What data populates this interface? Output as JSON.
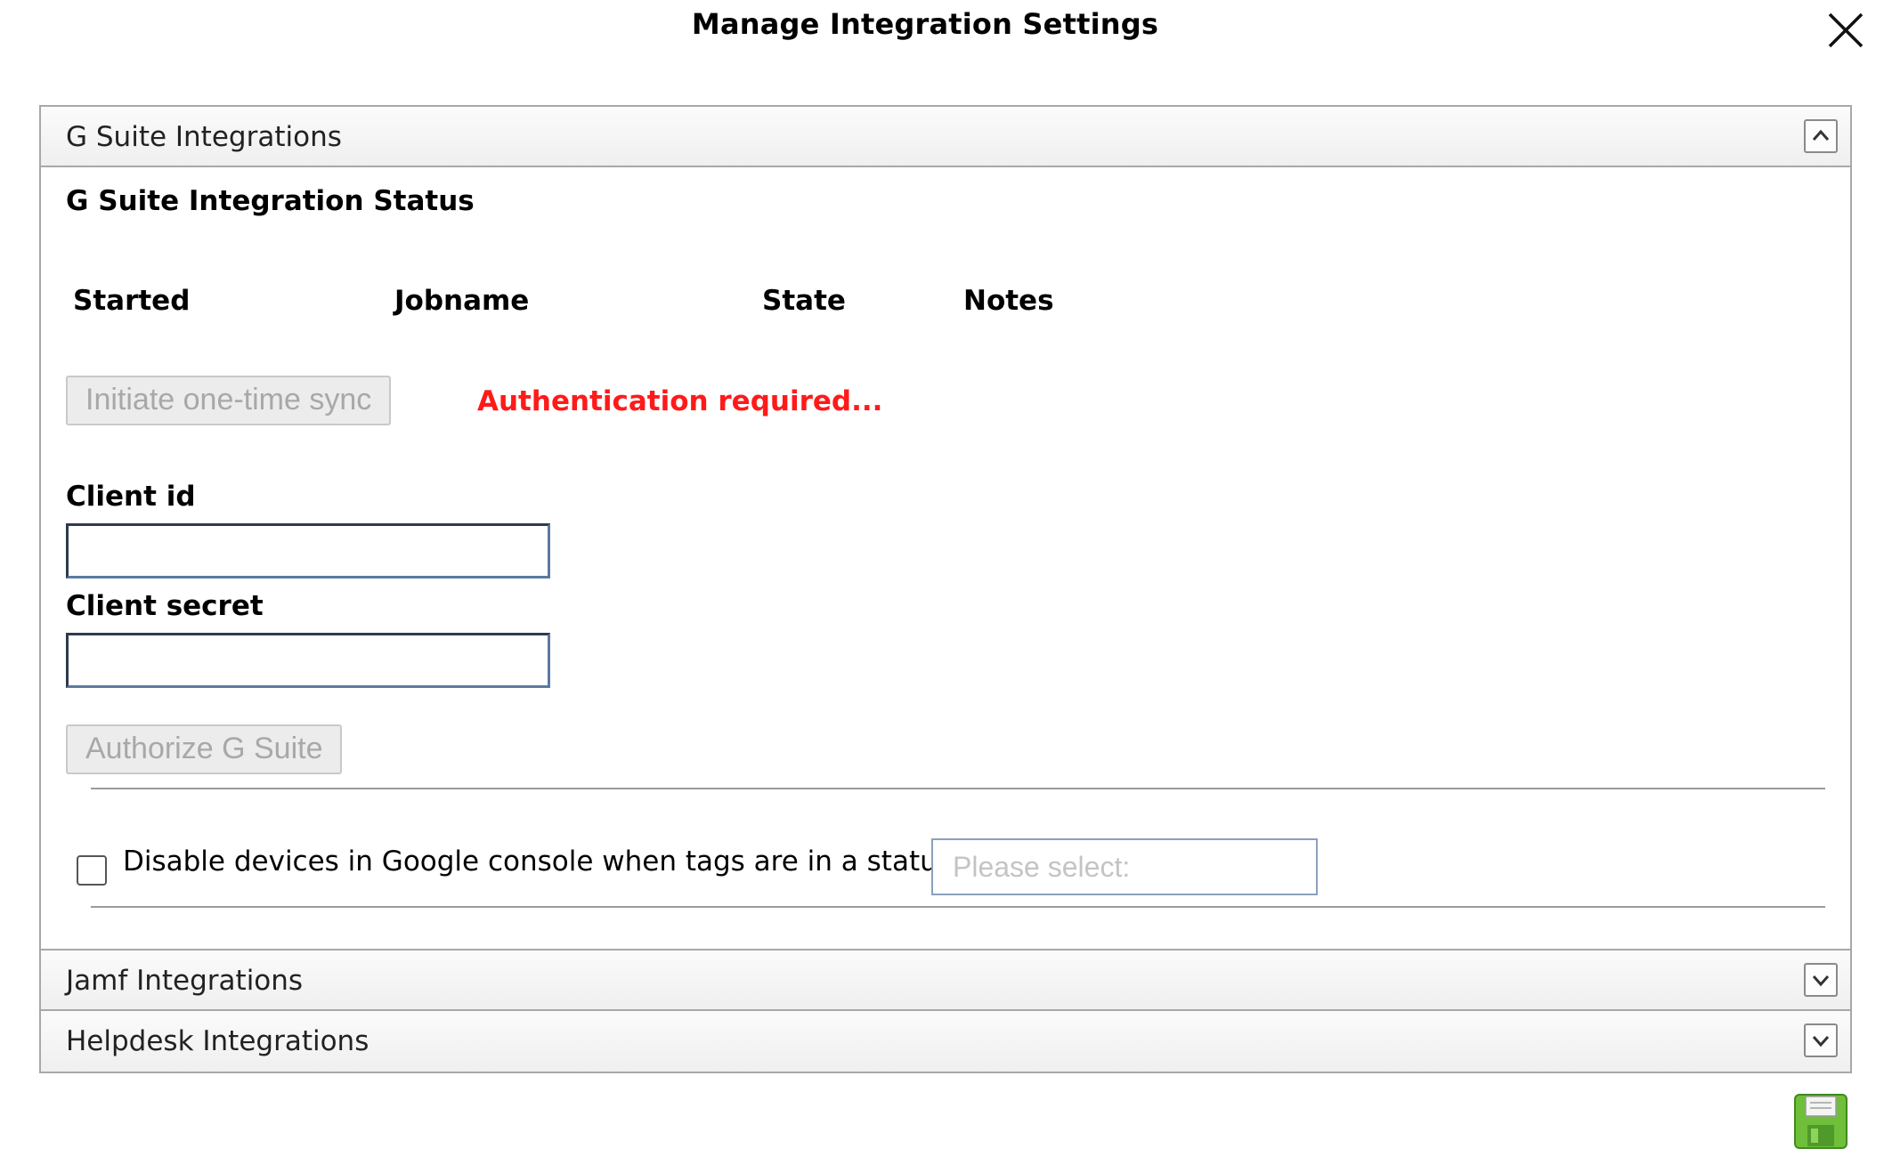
{
  "dialog": {
    "title": "Manage Integration Settings",
    "close_icon": "close-icon",
    "save_icon": "floppy-disk-save-icon"
  },
  "panels": [
    {
      "label": "G Suite Integrations",
      "expanded": true,
      "toggle_icon": "chevron-up-icon"
    },
    {
      "label": "Jamf Integrations",
      "expanded": false,
      "toggle_icon": "chevron-down-icon"
    },
    {
      "label": "Helpdesk Integrations",
      "expanded": false,
      "toggle_icon": "chevron-down-icon"
    }
  ],
  "gsuite": {
    "status_title": "G Suite Integration Status",
    "columns": [
      "Started",
      "Jobname",
      "State",
      "Notes"
    ],
    "sync_button": "Initiate one-time sync",
    "auth_message": "Authentication required...",
    "client_id_label": "Client id",
    "client_id_value": "",
    "client_secret_label": "Client secret",
    "client_secret_value": "",
    "authorize_button": "Authorize G Suite",
    "disable_checkbox_label": "Disable devices in Google console when tags are in a status of",
    "disable_checkbox_checked": false,
    "status_select_placeholder": "Please select:"
  },
  "colors": {
    "error": "#ff1a1a",
    "save_icon": "#6fbf3a"
  }
}
